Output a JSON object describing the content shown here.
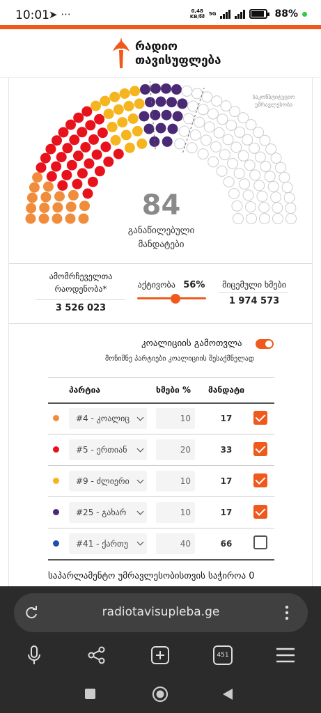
{
  "status_bar": {
    "time": "10:01",
    "left_icons": "➤ ···",
    "net_speed_top": "0,48",
    "net_speed_bottom": "KB/წმ",
    "net_type": "5G",
    "battery": "88%"
  },
  "header": {
    "logo_line1": "რადიო",
    "logo_line2": "თავისუფლება"
  },
  "seats": {
    "total": 150,
    "colors": {
      "orange": "#f08d3c",
      "red": "#e8121c",
      "yellow": "#f5b51f",
      "purple": "#4a2a74",
      "empty": "#ffffff"
    },
    "counts": {
      "orange": 17,
      "red": 33,
      "yellow": 17,
      "purple": 17,
      "empty": 66
    },
    "majority_label": "საკონსტიტუციო უმრავლესობა",
    "distributed_count": "84",
    "distributed_label_line1": "განაწილებული",
    "distributed_label_line2": "მანდატები"
  },
  "stats": {
    "voters_label_line1": "ამომრჩეველთა",
    "voters_label_line2": "რაოდენობა*",
    "voters_value": "3 526 023",
    "turnout_label": "აქტივობა",
    "turnout_value": "56%",
    "turnout_fraction": 0.56,
    "votes_label": "მიცემული ხმები",
    "votes_value": "1 974 573"
  },
  "coalition": {
    "label": "კოალიციის გამოთვლა",
    "hint": "მონიშნე პარტიები კოალიციის შესაქმნელად",
    "enabled": true
  },
  "table": {
    "headers": {
      "party": "პარტია",
      "votes_pct": "ხმები %",
      "mandates": "მანდატი"
    },
    "rows": [
      {
        "color": "#f08d3c",
        "party": "#4 - კოალიც",
        "pct": "10",
        "mandates": "17",
        "checked": true
      },
      {
        "color": "#e8121c",
        "party": "#5 - ერთიან",
        "pct": "20",
        "mandates": "33",
        "checked": true
      },
      {
        "color": "#f5b51f",
        "party": "#9 - ძლიერი",
        "pct": "10",
        "mandates": "17",
        "checked": true
      },
      {
        "color": "#4a2a74",
        "party": "#25 - გახარ",
        "pct": "10",
        "mandates": "17",
        "checked": true
      },
      {
        "color": "#1f4fae",
        "party": "#41 - ქართუ",
        "pct": "40",
        "mandates": "66",
        "checked": false
      }
    ]
  },
  "majority_text": "საპარლამენტო უმრავლესობისთვის საჭიროა 0",
  "browser": {
    "url": "radiotavisupleba.ge",
    "tab_count": "451"
  },
  "accent": "#ef5a1c"
}
